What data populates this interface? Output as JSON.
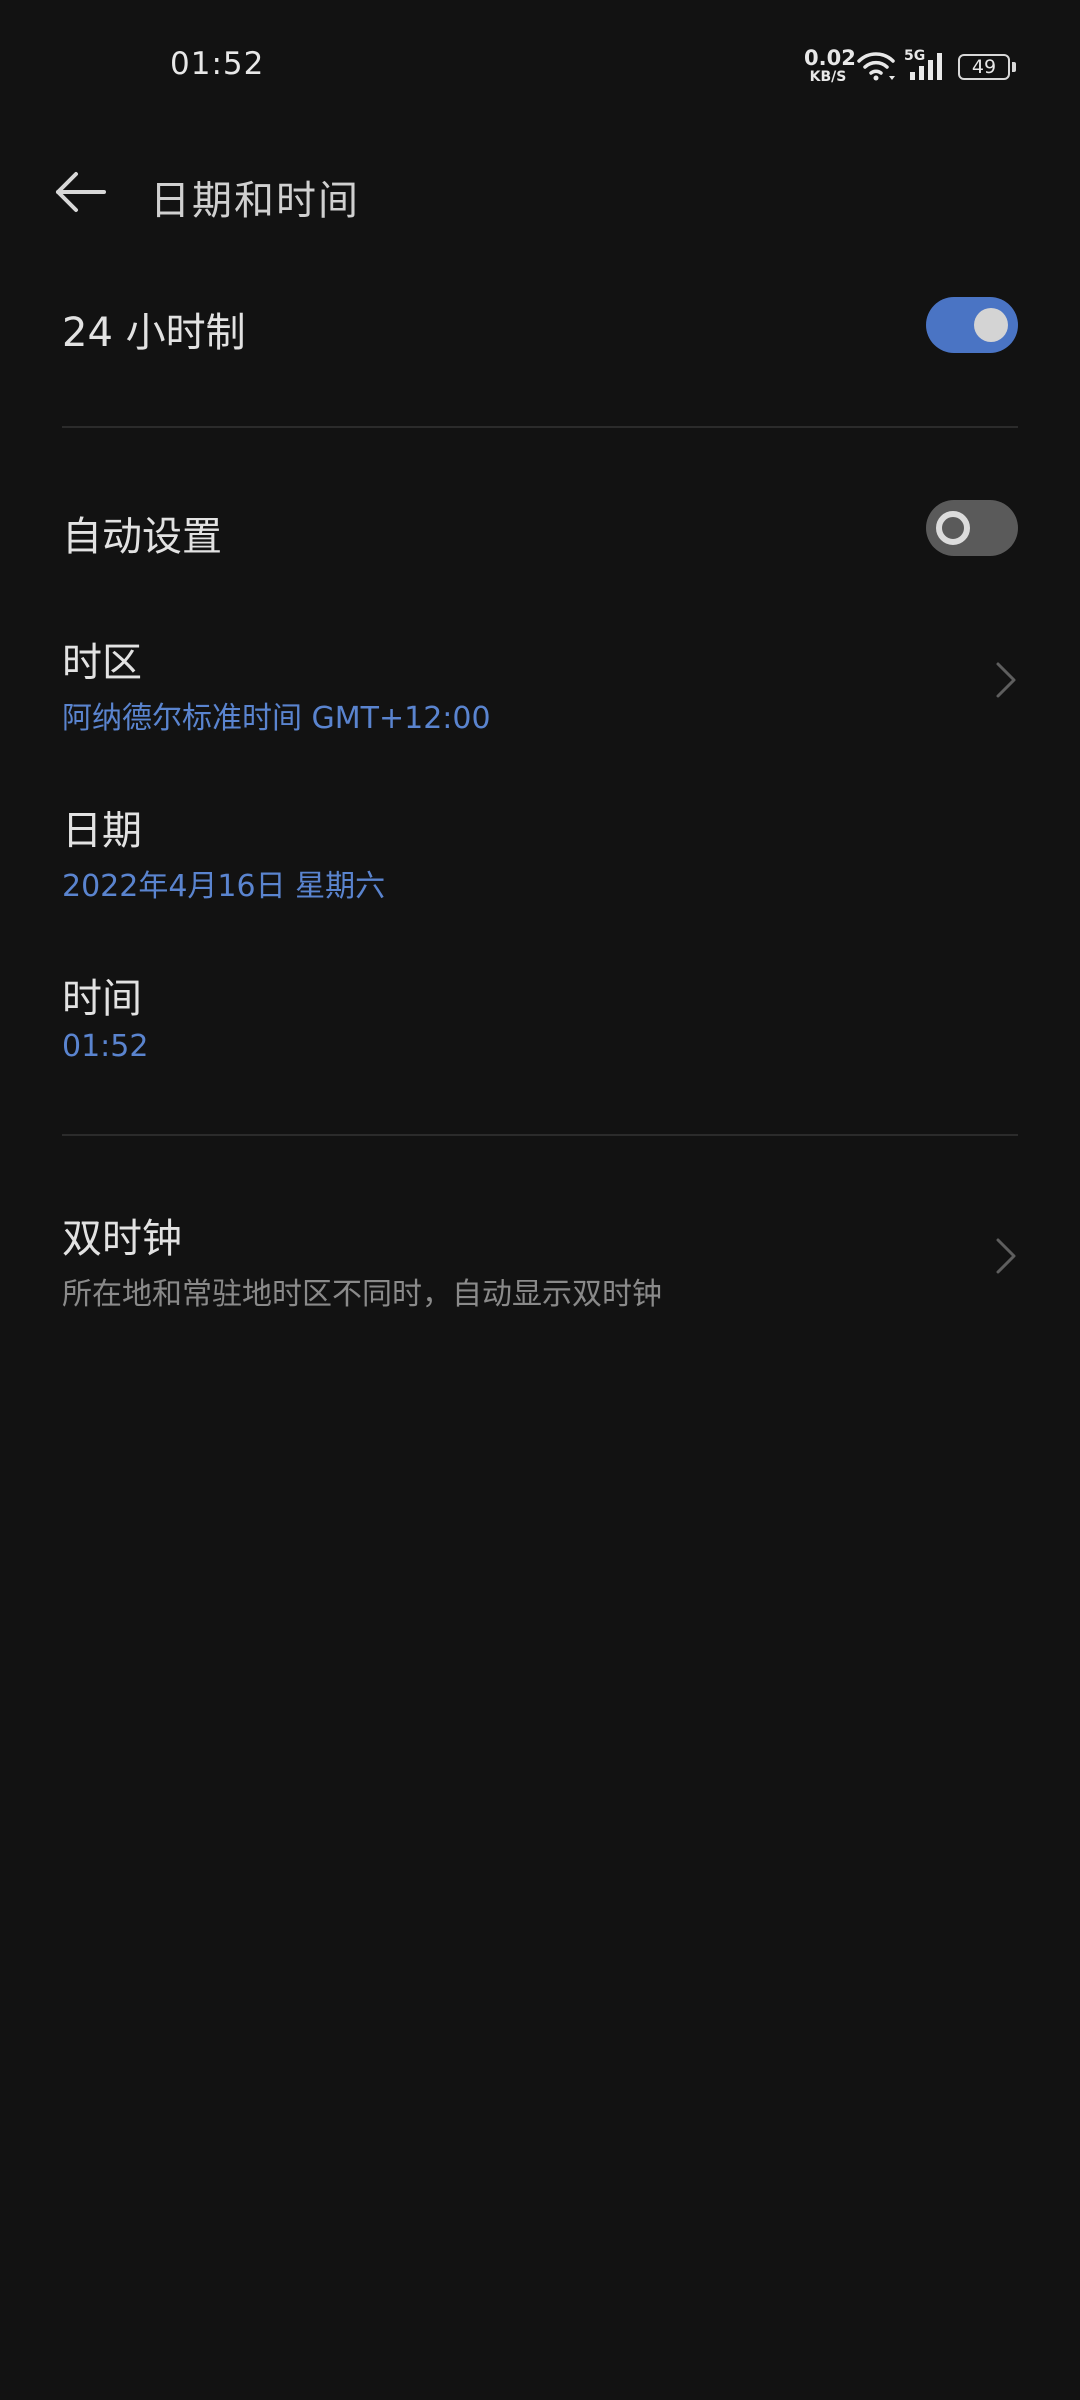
{
  "status_bar": {
    "time": "01:52",
    "net_speed_value": "0.02",
    "net_speed_unit": "KB/S",
    "network_type": "5G",
    "battery": "49",
    "icons": [
      "wifi-icon",
      "signal-icon",
      "battery-icon"
    ]
  },
  "header": {
    "title": "日期和时间",
    "back_icon": "arrow-left-icon"
  },
  "settings": {
    "hour24": {
      "label": "24 小时制",
      "enabled": true
    },
    "auto_set": {
      "label": "自动设置",
      "enabled": false
    },
    "timezone": {
      "label": "时区",
      "value": "阿纳德尔标准时间 GMT+12:00",
      "icon": "chevron-right-icon"
    },
    "date": {
      "label": "日期",
      "value": "2022年4月16日 星期六"
    },
    "time": {
      "label": "时间",
      "value": "01:52"
    },
    "dual_clock": {
      "label": "双时钟",
      "description": "所在地和常驻地时区不同时，自动显示双时钟",
      "icon": "chevron-right-icon"
    }
  },
  "colors": {
    "background": "#121212",
    "accent": "#4a74c4",
    "value_text": "#5a84cf",
    "toggle_off": "#5a5a5a"
  }
}
